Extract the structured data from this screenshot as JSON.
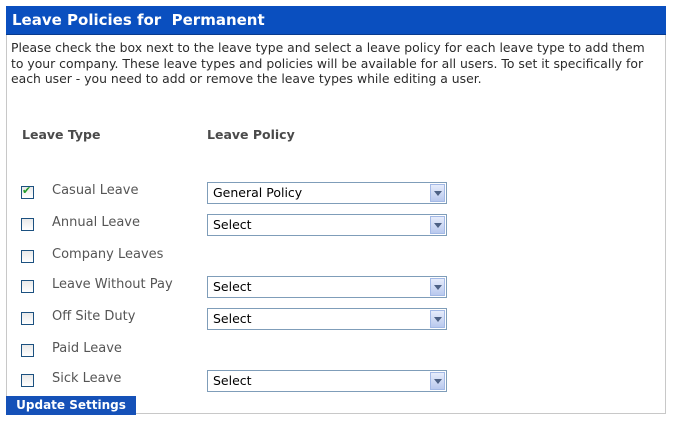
{
  "header": {
    "title": "Leave Policies for  Permanent"
  },
  "intro": "Please check the box next to the leave type and select a leave policy for each leave type to add them to your company. These leave types and policies will be available for all users. To set it specifically for each user - you need to add or remove the leave types while editing a user.",
  "columns": {
    "leave_type": "Leave Type",
    "leave_policy": "Leave Policy"
  },
  "rows": [
    {
      "label": "Casual Leave",
      "checked": true,
      "policy": "General Policy"
    },
    {
      "label": "Annual Leave",
      "checked": false,
      "policy": "Select"
    },
    {
      "label": "Company Leaves",
      "checked": false,
      "policy": null
    },
    {
      "label": "Leave Without Pay",
      "checked": false,
      "policy": "Select"
    },
    {
      "label": "Off Site Duty",
      "checked": false,
      "policy": "Select"
    },
    {
      "label": "Paid Leave",
      "checked": false,
      "policy": null
    },
    {
      "label": "Sick Leave",
      "checked": false,
      "policy": "Select"
    }
  ],
  "update_button": {
    "label": "Update Settings"
  },
  "colors": {
    "header_bg": "#0a4fbf",
    "button_bg": "#1551b8"
  }
}
